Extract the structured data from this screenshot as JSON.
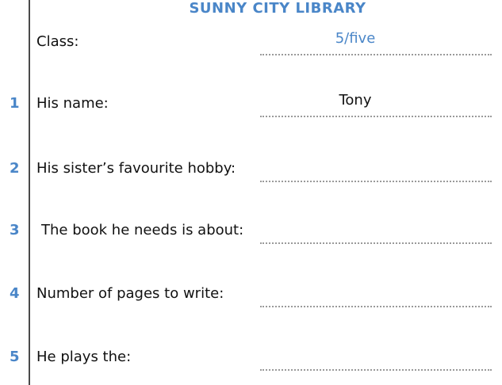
{
  "title": "SUNNY CITY LIBRARY",
  "rows": [
    {
      "number": "",
      "label": "Class:",
      "answer": "5/five"
    },
    {
      "number": "1",
      "label": "His name:",
      "answer": "Tony"
    },
    {
      "number": "2",
      "label": "His sister’s favourite hobby:",
      "answer": ""
    },
    {
      "number": "3",
      "label": "The book he needs is about:",
      "answer": ""
    },
    {
      "number": "4",
      "label": "Number of pages to write:",
      "answer": ""
    },
    {
      "number": "5",
      "label": "He plays the:",
      "answer": ""
    }
  ],
  "colors": {
    "accent": "#4a86c8",
    "text": "#111111",
    "dots": "#9a9a9a"
  }
}
